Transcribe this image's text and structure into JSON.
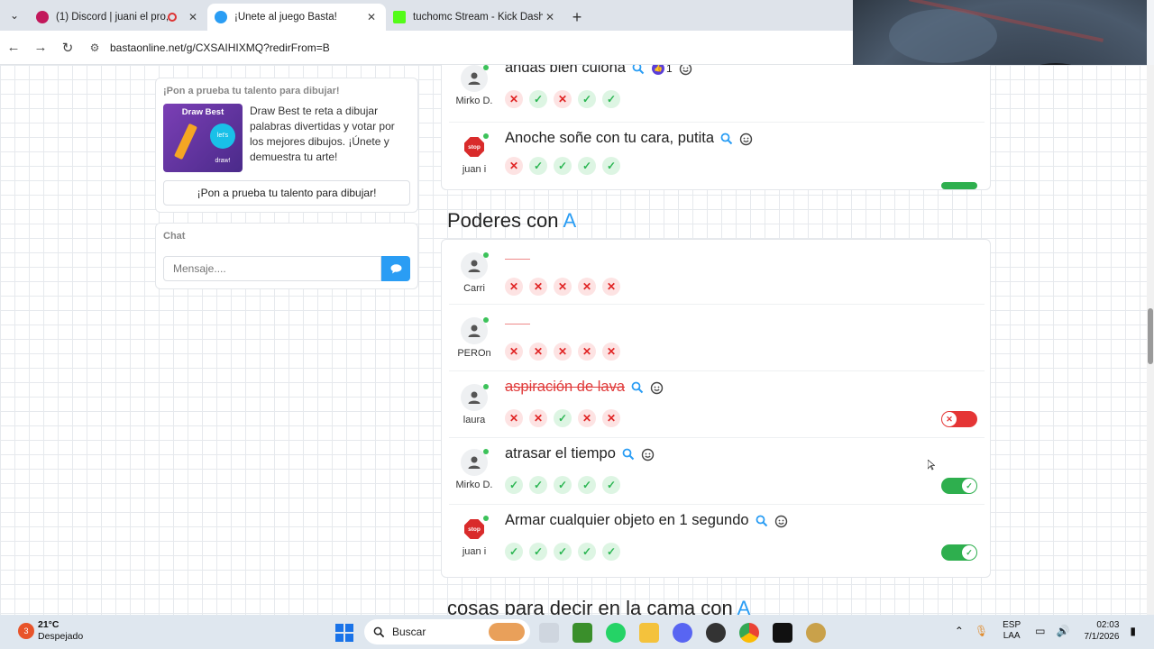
{
  "browser": {
    "tabs": [
      {
        "title": "(1) Discord | juani el pro, Lo",
        "active": false,
        "favicon_color": "#c2185b"
      },
      {
        "title": "¡Únete al juego Basta!",
        "active": true,
        "favicon_color": "#2a9df4"
      },
      {
        "title": "tuchomc Stream - Kick Dashbo",
        "active": false,
        "favicon_color": "#53fc18"
      }
    ],
    "new_tab_symbol": "+",
    "url": "bastaonline.net/g/CXSAIHIXMQ?redirFrom=B"
  },
  "sidebar": {
    "promo": {
      "title": "¡Pon a prueba tu talento para dibujar!",
      "image_label": "Draw Best",
      "image_badge": "let's draw!",
      "text": "Draw Best te reta a dibujar palabras divertidas y votar por los mejores dibujos. ¡Únete y demuestra tu arte!",
      "button_label": "¡Pon a prueba tu talento para dibujar!"
    },
    "chat": {
      "title": "Chat",
      "placeholder": "Mensaje...."
    }
  },
  "categories": [
    {
      "title": "",
      "rows": [
        {
          "user": "Mirko D.",
          "avatar": "person",
          "answer": "andas bien culona",
          "likes": "1",
          "votes": [
            "no",
            "yes",
            "no",
            "yes",
            "yes"
          ]
        },
        {
          "user": "juan i",
          "avatar": "stop",
          "answer": "Anoche soñe con tu cara, putita",
          "votes": [
            "no",
            "yes",
            "yes",
            "yes",
            "yes"
          ]
        }
      ]
    },
    {
      "title_prefix": "Poderes con ",
      "letter": "A",
      "rows": [
        {
          "user": "Carri",
          "avatar": "person",
          "answer": "",
          "votes": [
            "no",
            "no",
            "no",
            "no",
            "no"
          ]
        },
        {
          "user": "PEROn",
          "avatar": "person",
          "answer": "",
          "votes": [
            "no",
            "no",
            "no",
            "no",
            "no"
          ]
        },
        {
          "user": "laura",
          "avatar": "person",
          "answer": "aspiración de lava",
          "struck": true,
          "votes": [
            "no",
            "no",
            "yes",
            "no",
            "no"
          ],
          "toggle": "off"
        },
        {
          "user": "Mirko D.",
          "avatar": "person",
          "answer": "atrasar el tiempo",
          "votes": [
            "yes",
            "yes",
            "yes",
            "yes",
            "yes"
          ],
          "toggle": "on"
        },
        {
          "user": "juan i",
          "avatar": "stop",
          "answer": "Armar cualquier objeto en 1 segundo",
          "votes": [
            "yes",
            "yes",
            "yes",
            "yes",
            "yes"
          ],
          "toggle": "on"
        }
      ]
    },
    {
      "title_prefix": "cosas para decir en la cama con ",
      "letter": "A"
    }
  ],
  "stop_sign_text": "stop",
  "taskbar": {
    "weather_badge": "3",
    "temperature": "21°C",
    "condition": "Despejado",
    "search_label": "Buscar",
    "lang_1": "ESP",
    "lang_2": "LAA",
    "time": "02:03",
    "date": "7/1/2026"
  },
  "colors": {
    "accent": "#2a9df4",
    "yes": "#2cb653",
    "no": "#e02424",
    "toggle_on": "#2eaf4e",
    "toggle_off": "#e53535"
  }
}
